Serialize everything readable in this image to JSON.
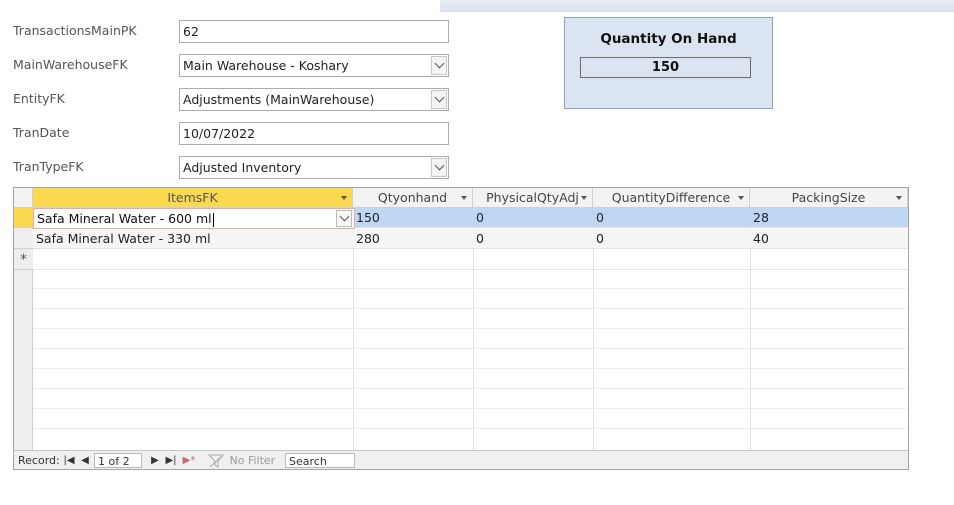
{
  "form": {
    "fields": [
      {
        "label": "TransactionsMainPK",
        "value": "62",
        "combo": false
      },
      {
        "label": "MainWarehouseFK",
        "value": "Main Warehouse - Koshary",
        "combo": true
      },
      {
        "label": "EntityFK",
        "value": "Adjustments (MainWarehouse)",
        "combo": true
      },
      {
        "label": "TranDate",
        "value": "10/07/2022",
        "combo": false
      },
      {
        "label": "TranTypeFK",
        "value": "Adjusted Inventory",
        "combo": true
      }
    ]
  },
  "qoh": {
    "title": "Quantity On Hand",
    "value": "150"
  },
  "grid": {
    "columns": [
      "ItemsFK",
      "Qtyonhand",
      "PhysicalQtyAdj",
      "QuantityDifference",
      "PackingSize"
    ],
    "rows": [
      [
        "Safa Mineral Water - 600 ml",
        "150",
        "0",
        "0",
        "28"
      ],
      [
        "Safa Mineral Water - 330 ml",
        "280",
        "0",
        "0",
        "40"
      ]
    ],
    "new_row_marker": "*"
  },
  "nav": {
    "record_label": "Record:",
    "first": "|◀",
    "prev": "◀",
    "position": "1 of 2",
    "next": "▶",
    "last": "▶|",
    "new": "▶*",
    "filter": "No Filter",
    "search": "Search"
  }
}
